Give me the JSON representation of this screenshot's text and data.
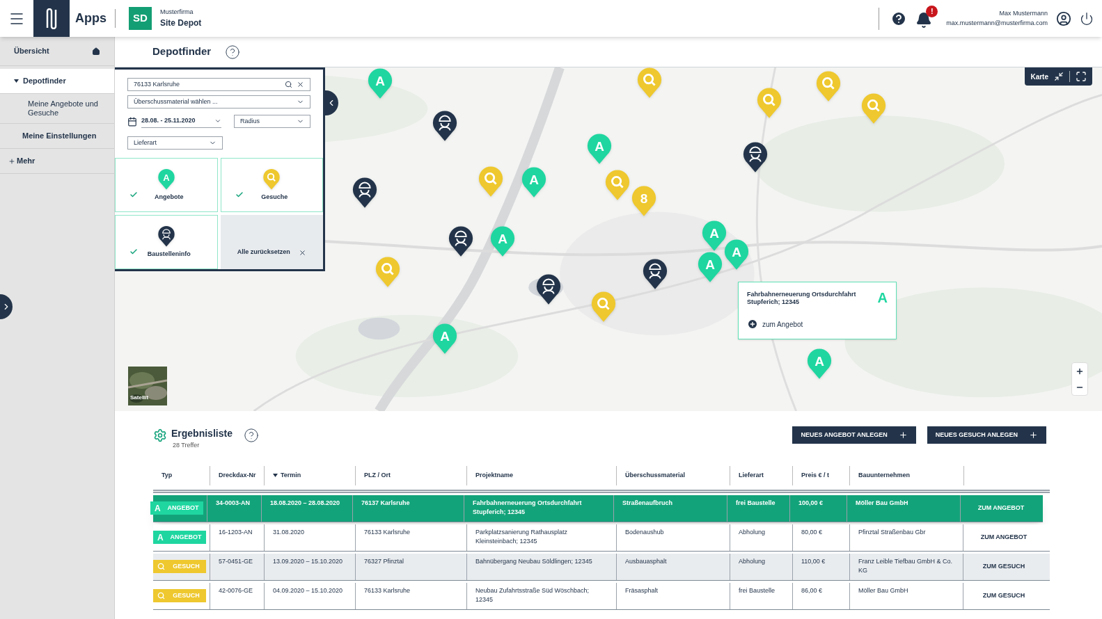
{
  "header": {
    "apps_label": "Apps",
    "app_badge": "SD",
    "company": "Musterfirma",
    "app_name": "Site Depot",
    "notification_badge": "!",
    "user_name": "Max Mustermann",
    "user_email": "max.mustermann@musterfirma.com"
  },
  "sidebar": {
    "items": [
      {
        "label": "Übersicht",
        "kind": "home",
        "selected": false
      },
      {
        "label": "Depotfinder",
        "kind": "section",
        "selected": true,
        "expanded": true,
        "children": [
          {
            "label": "Meine Angebote und Gesuche",
            "selected": false
          }
        ]
      },
      {
        "label": "Meine Einstellungen",
        "kind": "plain",
        "selected": false
      },
      {
        "label": "Mehr",
        "kind": "more",
        "selected": false
      }
    ]
  },
  "page_title": "Depotfinder",
  "filter": {
    "search_value": "76133 Karlsruhe",
    "material_placeholder": "Überschussmaterial wählen ...",
    "date_range": "28.08. - 25.11.2020",
    "radius_placeholder": "Radius",
    "delivery_placeholder": "Lieferart",
    "categories": [
      {
        "label": "Angebote",
        "kind": "angebot",
        "letter": "A",
        "checked": true
      },
      {
        "label": "Gesuche",
        "kind": "gesuch",
        "checked": true
      },
      {
        "label": "Baustelleninfo",
        "kind": "baustelle",
        "checked": true
      }
    ],
    "reset_label": "Alle zurücksetzen"
  },
  "map": {
    "view_label": "Karte",
    "satellite_label": "Satellit",
    "markers": [
      {
        "kind": "angebot",
        "label": "A"
      },
      {
        "kind": "angebot",
        "label": "A"
      },
      {
        "kind": "angebot",
        "label": "A"
      },
      {
        "kind": "angebot",
        "label": "A"
      },
      {
        "kind": "angebot",
        "label": "A"
      },
      {
        "kind": "angebot",
        "label": "A"
      },
      {
        "kind": "angebot",
        "label": "A"
      },
      {
        "kind": "angebot",
        "label": "A"
      },
      {
        "kind": "angebot",
        "label": "A"
      },
      {
        "kind": "gesuch"
      },
      {
        "kind": "gesuch"
      },
      {
        "kind": "gesuch"
      },
      {
        "kind": "gesuch"
      },
      {
        "kind": "gesuch"
      },
      {
        "kind": "gesuch"
      },
      {
        "kind": "gesuch"
      },
      {
        "kind": "gesuch"
      },
      {
        "kind": "baustelle"
      },
      {
        "kind": "baustelle"
      },
      {
        "kind": "baustelle"
      },
      {
        "kind": "baustelle"
      },
      {
        "kind": "baustelle"
      },
      {
        "kind": "baustelle"
      },
      {
        "kind": "cluster",
        "label": "8"
      }
    ],
    "popup": {
      "title": "Fahrbahnerneuerung Ortsdurchfahrt Stupferich; 12345",
      "letter": "A",
      "link": "zum Angebot"
    }
  },
  "results": {
    "title": "Ergebnisliste",
    "count": "28 Treffer",
    "buttons": [
      "NEUES ANGEBOT ANLEGEN",
      "NEUES GESUCH ANLEGEN"
    ],
    "columns": [
      {
        "label": "Typ",
        "sorted": false
      },
      {
        "label": "Dreckdax-Nr",
        "sorted": false
      },
      {
        "label": "Termin",
        "sorted": true
      },
      {
        "label": "PLZ / Ort",
        "sorted": false
      },
      {
        "label": "Projektname",
        "sorted": false
      },
      {
        "label": "Überschussmaterial",
        "sorted": false
      },
      {
        "label": "Lieferart",
        "sorted": false
      },
      {
        "label": "Preis € / t",
        "sorted": false
      },
      {
        "label": "Bauunternehmen",
        "sorted": false
      }
    ],
    "rows": [
      {
        "kind": "angebot",
        "letter": "A",
        "selected": true,
        "cells": [
          "ANGEBOT",
          "34-0003-AN",
          "18.08.2020 – 28.08.2020",
          "76137 Karlsruhe",
          "Fahrbahnerneuerung Ortsdurchfahrt Stupferich; 12345",
          "Straßenaufbruch",
          "frei Baustelle",
          "100,00 €",
          "Möller Bau GmbH"
        ],
        "action": "ZUM ANGEBOT"
      },
      {
        "kind": "angebot",
        "letter": "A",
        "selected": false,
        "cells": [
          "ANGEBOT",
          "16-1203-AN",
          "31.08.2020",
          "76133 Karlsruhe",
          "Parkplatzsanierung Rathausplatz Kleinsteinbach; 12345",
          "Bodenaushub",
          "Abholung",
          "80,00 €",
          "Pfinztal Straßenbau Gbr"
        ],
        "action": "ZUM ANGEBOT"
      },
      {
        "kind": "gesuch",
        "selected": false,
        "cells": [
          "GESUCH",
          "57-0451-GE",
          "13.09.2020 – 15.10.2020",
          "76327 Pfinztal",
          "Bahnübergang Neubau Söldlingen; 12345",
          "Ausbauasphalt",
          "Abholung",
          "110,00 €",
          "Franz Leible Tiefbau GmbH & Co. KG"
        ],
        "action": "ZUM GESUCH"
      },
      {
        "kind": "gesuch",
        "selected": false,
        "cells": [
          "GESUCH",
          "42-0076-GE",
          "04.09.2020 – 15.10.2020",
          "76133 Karlsruhe",
          "Neubau Zufahrtsstraße Süd Wöschbach; 12345",
          "Fräsasphalt",
          "frei Baustelle",
          "86,00 €",
          "Möller Bau GmbH"
        ],
        "action": "ZUM GESUCH"
      }
    ]
  }
}
